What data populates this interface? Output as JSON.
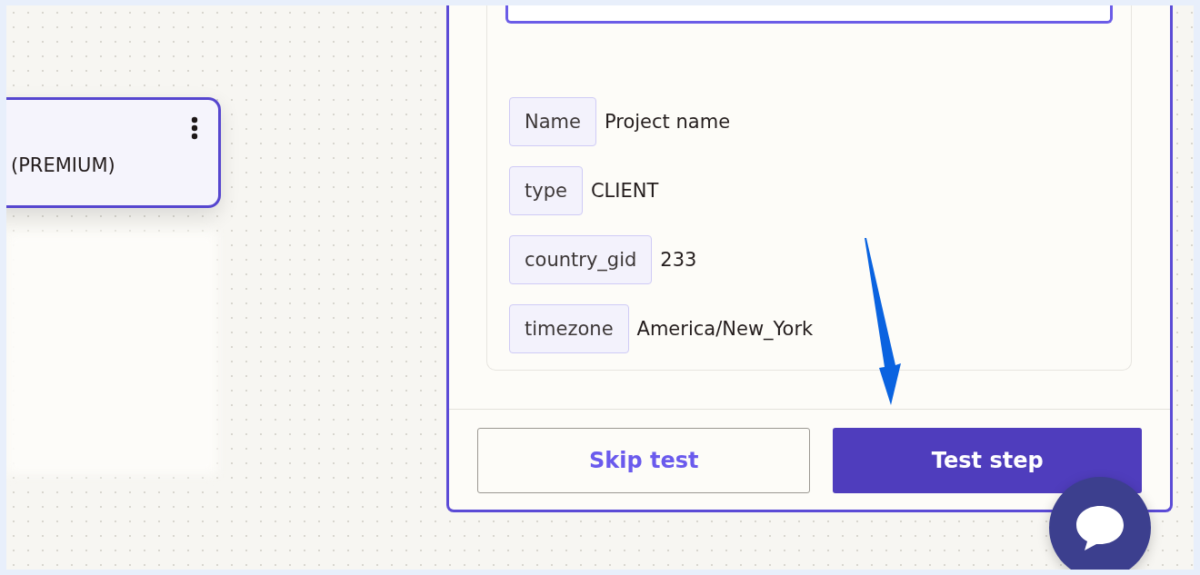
{
  "node_card": {
    "label": "(PREMIUM)"
  },
  "fields": [
    {
      "key": "Name",
      "value": "Project name"
    },
    {
      "key": "type",
      "value": "CLIENT"
    },
    {
      "key": "country_gid",
      "value": "233"
    },
    {
      "key": "timezone",
      "value": "America/New_York"
    }
  ],
  "buttons": [
    {
      "kind": "secondary",
      "label": "Skip test"
    },
    {
      "kind": "primary",
      "label": "Test step"
    }
  ]
}
